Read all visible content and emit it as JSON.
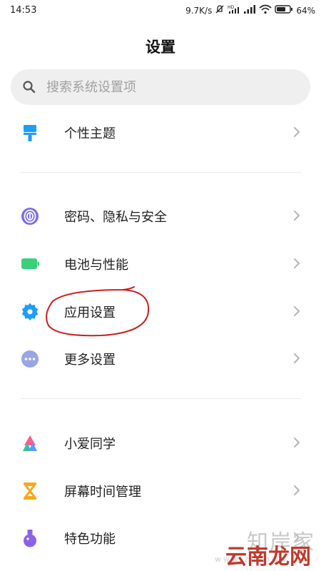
{
  "status_bar": {
    "time": "14:53",
    "network_speed": "9.7K/s",
    "battery": "64%",
    "icons": [
      "mute-icon",
      "hd-icon",
      "signal-icon",
      "signal-icon",
      "wifi-icon",
      "battery-icon"
    ]
  },
  "header": {
    "title": "设置"
  },
  "search": {
    "placeholder": "搜索系统设置项"
  },
  "items": [
    {
      "label": "个性主题",
      "icon": "theme-brush-icon",
      "color": "#1e9ef5"
    },
    {
      "label": "密码、隐私与安全",
      "icon": "fingerprint-icon",
      "color": "#7a6cf0"
    },
    {
      "label": "电池与性能",
      "icon": "battery-icon",
      "color": "#3ad07a"
    },
    {
      "label": "应用设置",
      "icon": "gear-icon",
      "color": "#1e9ef5"
    },
    {
      "label": "更多设置",
      "icon": "more-dots-icon",
      "color": "#98a6e6"
    },
    {
      "label": "小爱同学",
      "icon": "xiaoai-icon",
      "color": "#3bbfa3"
    },
    {
      "label": "屏幕时间管理",
      "icon": "hourglass-icon",
      "color": "#f7a81b"
    },
    {
      "label": "特色功能",
      "icon": "flask-icon",
      "color": "#8c63e8"
    }
  ],
  "watermark": {
    "top": "知岸家",
    "sub": "www.zhaojia...",
    "main": "云南龙网"
  },
  "colors": {
    "chevron": "#b5b5b5",
    "annotation": "#cc1f1f"
  }
}
